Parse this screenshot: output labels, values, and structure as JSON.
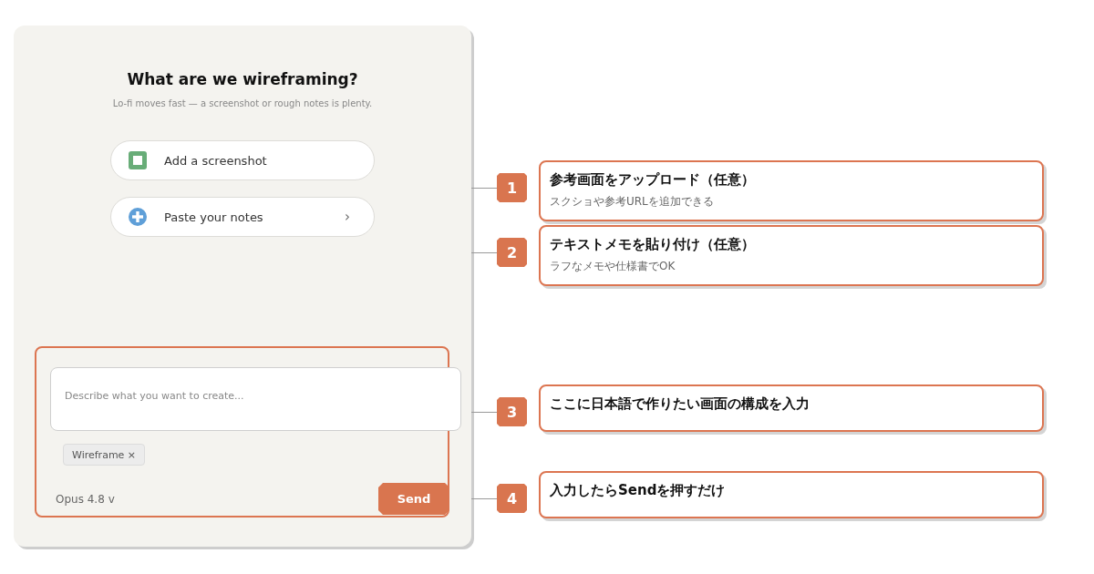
{
  "panel": {
    "title": "What are we wireframing?",
    "subtitle": "Lo-fi moves fast — a screenshot or rough notes is plenty.",
    "options": [
      {
        "kind": "screenshot",
        "label": "Add a screenshot"
      },
      {
        "kind": "notes",
        "label": "Paste your notes",
        "trailing": "›"
      }
    ]
  },
  "composer": {
    "placeholder": "Describe what you want to create...",
    "tags": [
      {
        "label": "Wireframe",
        "remove": "×"
      }
    ],
    "model": "Opus 4.8",
    "model_caret": "v",
    "send": "Send"
  },
  "callouts": [
    {
      "number": "1",
      "title": "参考画面をアップロード（任意）",
      "note": "スクショや参考URLを追加できる"
    },
    {
      "number": "2",
      "title": "テキストメモを貼り付け（任意）",
      "note": "ラフなメモや仕様書でOK"
    },
    {
      "number": "3",
      "title": "ここに日本語で作りたい画面の構成を入力"
    },
    {
      "number": "4",
      "title": "入力したらSendを押すだけ"
    }
  ]
}
